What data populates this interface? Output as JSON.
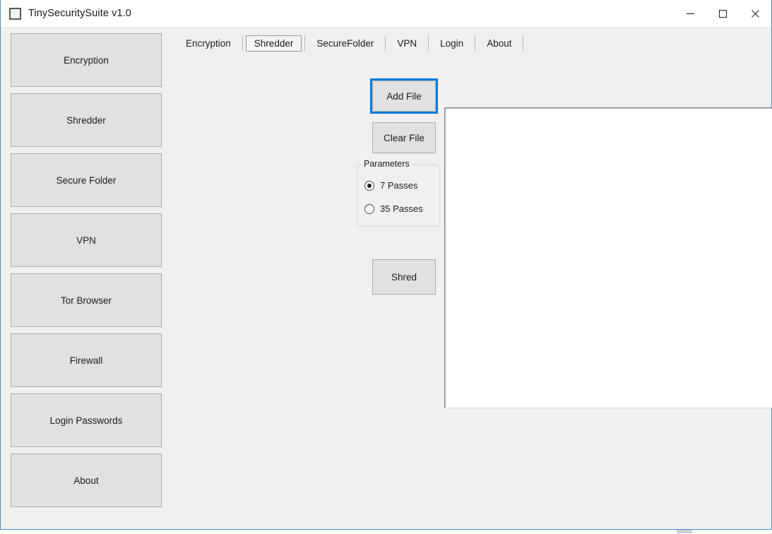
{
  "window": {
    "title": "TinySecuritySuite v1.0",
    "app_icon": "app-square-icon",
    "controls": {
      "minimize": "minimize-icon",
      "maximize": "maximize-icon",
      "close": "close-icon"
    }
  },
  "sidebar": {
    "items": [
      {
        "label": "Encryption"
      },
      {
        "label": "Shredder"
      },
      {
        "label": "Secure Folder"
      },
      {
        "label": "VPN"
      },
      {
        "label": "Tor Browser"
      },
      {
        "label": "Firewall"
      },
      {
        "label": "Login Passwords"
      },
      {
        "label": "About"
      }
    ]
  },
  "tabs": {
    "selected": "Shredder",
    "items": [
      {
        "label": "Encryption",
        "selected": false
      },
      {
        "label": "Shredder",
        "selected": true
      },
      {
        "label": "SecureFolder",
        "selected": false
      },
      {
        "label": "VPN",
        "selected": false
      },
      {
        "label": "Login",
        "selected": false
      },
      {
        "label": "About",
        "selected": false
      }
    ]
  },
  "shredder": {
    "add_file_label": "Add File",
    "clear_file_label": "Clear File",
    "shred_label": "Shred",
    "parameters": {
      "legend": "Parameters",
      "options": [
        {
          "label": "7 Passes",
          "selected": true
        },
        {
          "label": "35 Passes",
          "selected": false
        }
      ]
    },
    "file_list": {
      "items": []
    }
  },
  "colors": {
    "accent_focus": "#0078d7",
    "window_border": "#4a90c9",
    "button_face": "#e1e1e1",
    "background": "#f0f0f0"
  }
}
